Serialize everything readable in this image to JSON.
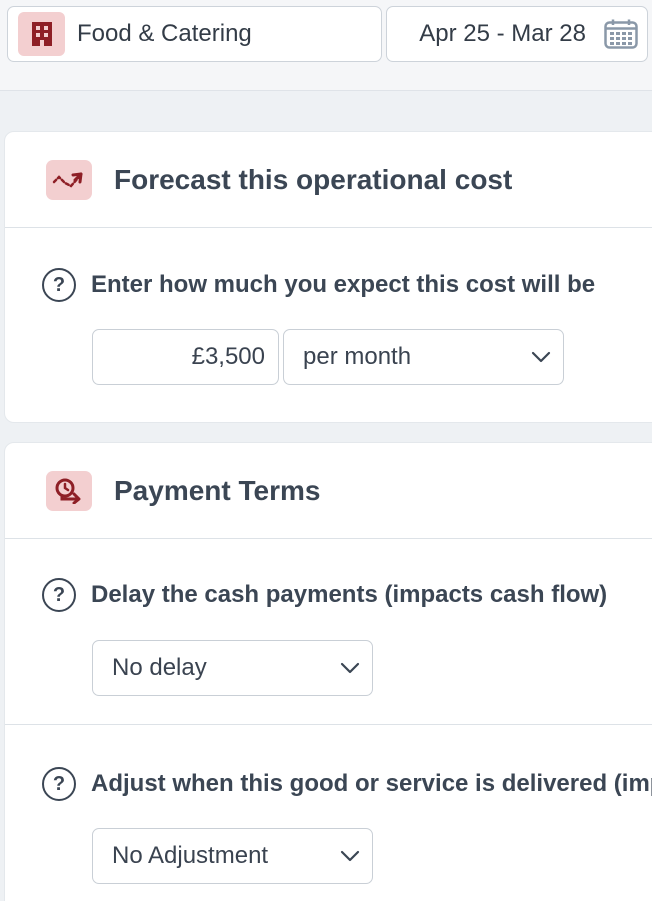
{
  "topbar": {
    "category_icon": "building-icon",
    "category_label": "Food & Catering",
    "date_range": "Apr 25 - Mar 28",
    "date_icon": "calendar-icon"
  },
  "forecast_card": {
    "icon": "trend-arrow-icon",
    "title": "Forecast this operational cost",
    "question_icon": "help-icon",
    "question": "Enter how much you expect this cost will be",
    "amount_value": "£3,500",
    "frequency_selected": "per month"
  },
  "payment_card": {
    "icon": "payment-delay-icon",
    "title": "Payment Terms",
    "delay_question": "Delay the cash payments (impacts cash flow)",
    "delay_selected": "No delay",
    "delivery_question": "Adjust when this good or service is delivered (impa",
    "delivery_selected": "No Adjustment"
  },
  "colors": {
    "accent_bg": "#f3cfd0",
    "accent_icon": "#8e1f26",
    "text": "#3b4654",
    "page_bg": "#eef1f4"
  }
}
